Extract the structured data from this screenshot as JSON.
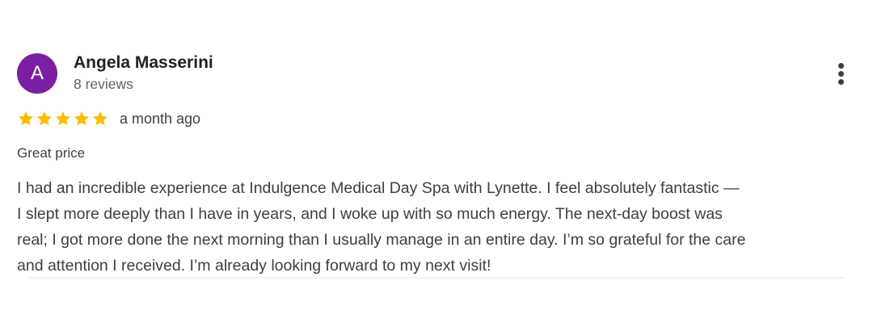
{
  "review": {
    "avatar_letter": "A",
    "reviewer_name": "Angela Masserini",
    "reviewer_review_count": "8 reviews",
    "rating": 5,
    "rating_max": 5,
    "time_ago": "a month ago",
    "headline": "Great price",
    "body_lines": [
      "I had an incredible experience at Indulgence Medical Day Spa with Lynette. I feel absolutely fantastic —",
      "I slept more deeply than I have in years, and I woke up with so much energy. The next-day boost was",
      "real; I got more done the next morning than I usually manage in an entire day. I’m so grateful for the care",
      "and attention I received. I’m already looking forward to my next visit!"
    ]
  },
  "icons": {
    "star": "star-icon",
    "menu": "more-vert-icon"
  },
  "colors": {
    "avatar_bg": "#7b1fa2",
    "star": "#fbbc04",
    "text_primary": "#202124",
    "text_secondary": "#5f6368"
  }
}
